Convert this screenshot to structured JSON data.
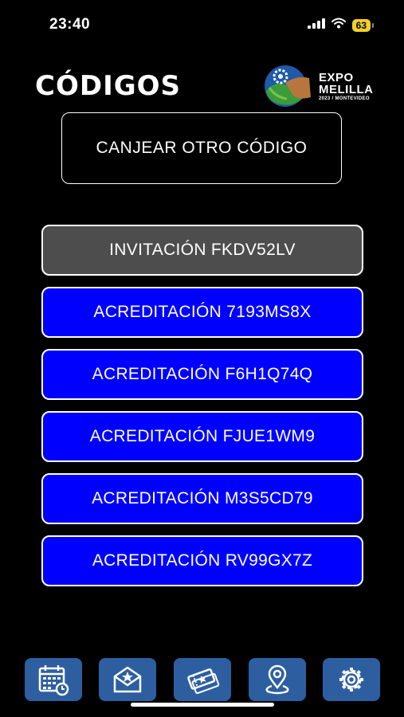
{
  "status_bar": {
    "time": "23:40",
    "battery": "63",
    "icons": [
      "signal-icon",
      "wifi-icon",
      "battery-icon"
    ]
  },
  "header": {
    "title": "CÓDIGOS",
    "logo": {
      "line1": "EXPO",
      "line2": "MELILLA",
      "line3": "2023 / MONTEVIDEO"
    }
  },
  "redeem_button": {
    "label": "CANJEAR OTRO CÓDIGO"
  },
  "codes": [
    {
      "label": "INVITACIÓN FKDV52LV",
      "type": "invitation"
    },
    {
      "label": "ACREDITACIÓN 7193MS8X",
      "type": "accreditation"
    },
    {
      "label": "ACREDITACIÓN F6H1Q74Q",
      "type": "accreditation"
    },
    {
      "label": "ACREDITACIÓN FJUE1WM9",
      "type": "accreditation"
    },
    {
      "label": "ACREDITACIÓN M3S5CD79",
      "type": "accreditation"
    },
    {
      "label": "ACREDITACIÓN RV99GX7Z",
      "type": "accreditation"
    }
  ],
  "tabs": [
    {
      "icon": "calendar-icon"
    },
    {
      "icon": "envelope-icon"
    },
    {
      "icon": "tickets-icon"
    },
    {
      "icon": "map-pin-icon"
    },
    {
      "icon": "gear-icon"
    }
  ],
  "colors": {
    "background": "#000000",
    "invitation": "#4d4d4d",
    "accreditation": "#0000ff",
    "tab": "#2d5fa0",
    "battery": "#f2d026"
  }
}
